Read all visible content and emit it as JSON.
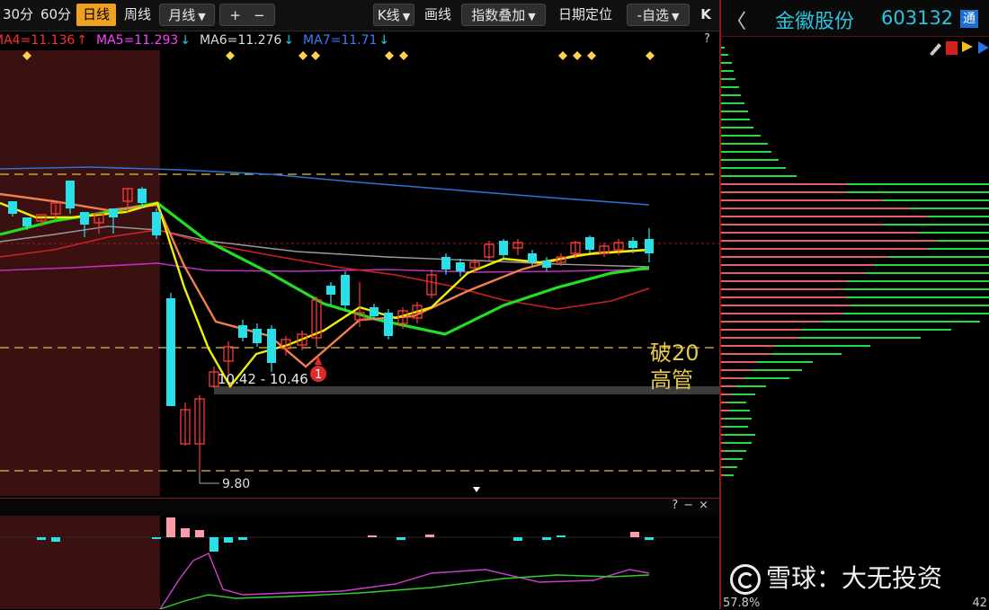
{
  "toolbar": {
    "periods": [
      "30分",
      "60分",
      "日线",
      "周线",
      "月线"
    ],
    "active_period": "日线",
    "plus_label": "+",
    "minus_label": "−",
    "kline_label": "K线",
    "draw_label": "画线",
    "index_overlay_label": "指数叠加",
    "date_locate_label": "日期定位",
    "watchlist_label": "-自选",
    "collapse_label": "K"
  },
  "ma_bar": {
    "items": [
      {
        "text": "MA4=11.136",
        "color": "#ff3030",
        "arrow": "↑",
        "arrow_color": "#ff3030"
      },
      {
        "text": "MA5=11.293",
        "color": "#ff40ff",
        "arrow": "↓",
        "arrow_color": "#29c6e0"
      },
      {
        "text": "MA6=11.276",
        "color": "#dddddd",
        "arrow": "↓",
        "arrow_color": "#29c6e0"
      },
      {
        "text": "MA7=11.71",
        "color": "#3a7cff",
        "arrow": "↓",
        "arrow_color": "#29c6e0"
      }
    ],
    "help": "?"
  },
  "chart": {
    "range_label": "10.42 - 10.46",
    "low_label": "9.80",
    "signal_badge": "1",
    "annotation_lines": [
      "破20",
      "高管"
    ]
  },
  "sub_panel": {
    "help": "?",
    "close": "×",
    "dash": "−"
  },
  "right_panel": {
    "back": "〈",
    "stock_name": "金徽股份",
    "stock_code": "603132",
    "badge": "通",
    "footer_left": "57.8%",
    "footer_right": "42"
  },
  "watermark": {
    "text": "雪球：大无投资"
  },
  "colors": {
    "up": "#ff3a3a",
    "down": "#29e0e8",
    "ma_short": "#f0f000",
    "ma_mid": "#f08050",
    "ma_long": "#20e020",
    "highlight": "#3a1010"
  }
}
